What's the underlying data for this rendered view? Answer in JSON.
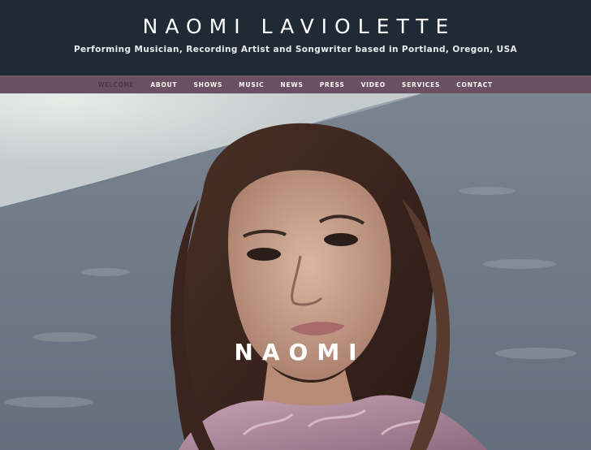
{
  "header": {
    "title": "NAOMI LAVIOLETTE",
    "tagline": "Performing Musician, Recording Artist and Songwriter based in Portland, Oregon, USA"
  },
  "nav": {
    "items": [
      {
        "label": "WELCOME",
        "active": true
      },
      {
        "label": "ABOUT"
      },
      {
        "label": "SHOWS"
      },
      {
        "label": "MUSIC"
      },
      {
        "label": "NEWS"
      },
      {
        "label": "PRESS"
      },
      {
        "label": "VIDEO"
      },
      {
        "label": "SERVICES"
      },
      {
        "label": "CONTACT"
      }
    ]
  },
  "hero": {
    "title": "NAOMI"
  },
  "colors": {
    "header_bg": "#1f2a36",
    "nav_bg": "#6b4f62",
    "active_nav_text": "#3a2b35"
  }
}
